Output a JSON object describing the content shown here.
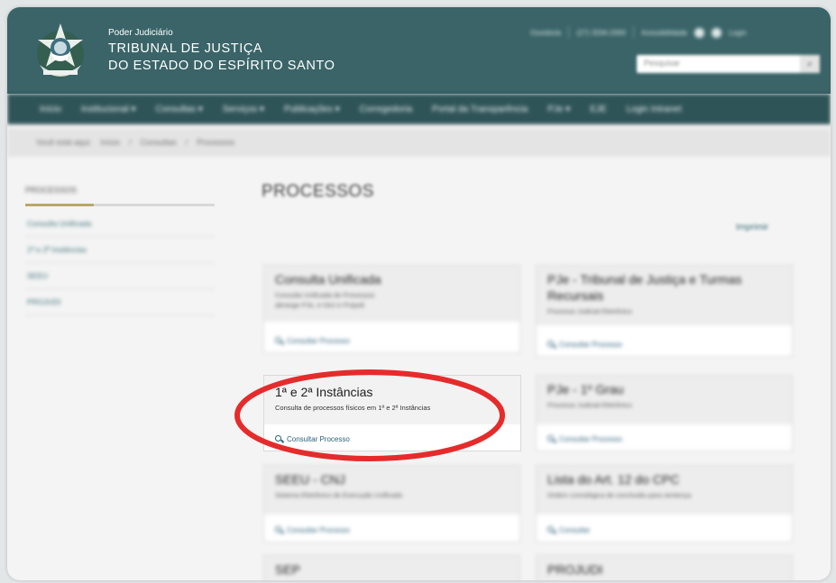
{
  "header": {
    "sub": "Poder Judiciário",
    "line1": "TRIBUNAL DE JUSTIÇA",
    "line2": "DO ESTADO DO ESPÍRITO SANTO",
    "toplinks": [
      "Ouvidoria",
      "(27) 3334-2000",
      "Acessibilidade",
      "Login"
    ],
    "search_placeholder": "Pesquisar",
    "search_icon": "search-icon"
  },
  "nav": [
    "Início",
    "Institucional ▾",
    "Consultas ▾",
    "Serviços ▾",
    "Publicações ▾",
    "Corregedoria",
    "Portal da Transparência",
    "PJe ▾",
    "EJE",
    "Login Intranet"
  ],
  "breadcrumbs": [
    "Você está aqui:",
    "Início",
    "/",
    "Consultas",
    "/",
    "Processos"
  ],
  "sidebar": {
    "title": "PROCESSOS",
    "items": [
      "Consulta Unificada",
      "1ª e 2ª Instâncias",
      "SEEU",
      "PROJUDI"
    ]
  },
  "main": {
    "title": "PROCESSOS",
    "print": "Imprimir"
  },
  "cards": [
    {
      "title": "Consulta Unificada",
      "desc": "Consulta Unificada de Processos",
      "desc2": "abrange PJe, e-SAJ e Projudi",
      "link": "Consultar Processo"
    },
    {
      "title": "PJe - Tribunal de Justiça e Turmas Recursais",
      "desc": "Processo Judicial Eletrônico",
      "link": "Consultar Processo"
    },
    {
      "title": "1ª e 2ª Instâncias",
      "desc": "Consulta de processos físicos em 1ª e 2ª Instâncias",
      "link": "Consultar Processo"
    },
    {
      "title": "PJe - 1º Grau",
      "desc": "Processo Judicial Eletrônico",
      "link": "Consultar Processo"
    },
    {
      "title": "SEEU - CNJ",
      "desc": "Sistema Eletrônico de Execução Unificado",
      "link": "Consultar Processo"
    },
    {
      "title": "Lista do Art. 12 do CPC",
      "desc": "Ordem cronológica de conclusão para sentença",
      "link": "Consultar"
    },
    {
      "title": "SEP",
      "desc": "",
      "link": ""
    },
    {
      "title": "PROJUDI",
      "desc": "",
      "link": ""
    }
  ],
  "highlight_color": "#e52b2b"
}
